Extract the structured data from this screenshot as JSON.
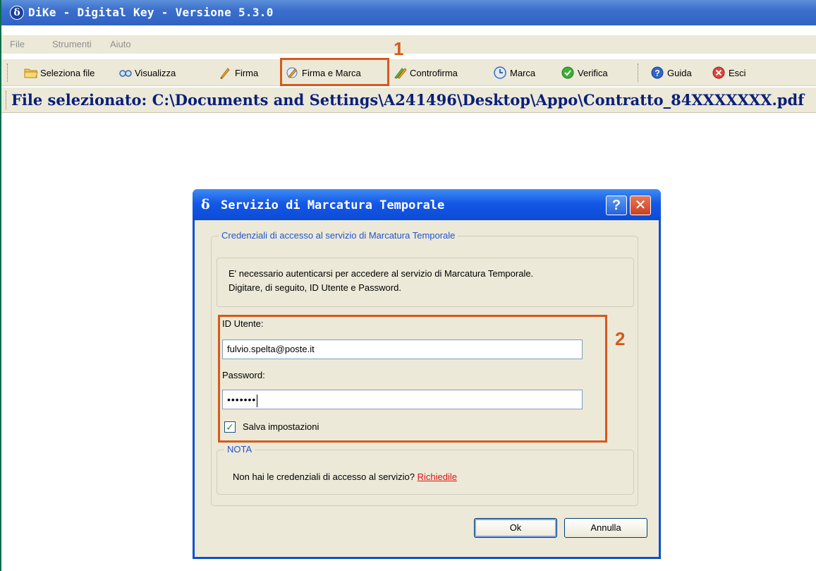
{
  "window": {
    "title": "DiKe - Digital Key - Versione 5.3.0",
    "icon": "delta-icon"
  },
  "menu": [
    "File",
    "Strumenti",
    "Aiuto"
  ],
  "toolbar": {
    "items": [
      {
        "label": "Seleziona file",
        "icon": "folder-icon"
      },
      {
        "label": "Visualizza",
        "icon": "view-icon"
      },
      {
        "label": "Firma",
        "icon": "pen-icon"
      },
      {
        "label": "Firma e Marca",
        "icon": "sign-stamp-icon"
      },
      {
        "label": "Controfirma",
        "icon": "countersign-icon"
      },
      {
        "label": "Marca",
        "icon": "clock-icon"
      },
      {
        "label": "Verifica",
        "icon": "check-icon"
      },
      {
        "label": "Guida",
        "icon": "help-icon"
      },
      {
        "label": "Esci",
        "icon": "exit-icon"
      }
    ]
  },
  "callouts": {
    "one": "1",
    "two": "2"
  },
  "file_bar": {
    "text": "File selezionato: C:\\Documents and Settings\\A241496\\Desktop\\Appo\\Contratto_84XXXXXXX.pdf"
  },
  "dialog": {
    "title": "Servizio di Marcatura Temporale",
    "help_button": "?",
    "close_button": "✕",
    "group_title": "Credenziali di accesso al servizio di Marcatura Temporale",
    "info_line1": "E' necessario autenticarsi per accedere al servizio di Marcatura Temporale.",
    "info_line2": "Digitare, di seguito, ID Utente e Password.",
    "user_label": "ID Utente:",
    "user_value": "fulvio.spelta@poste.it",
    "password_label": "Password:",
    "password_value": "•••••••",
    "save_label": "Salva impostazioni",
    "save_checked": true,
    "note_title": "NOTA",
    "note_text": "Non hai le credenziali di accesso al servizio?",
    "note_link": "Richiedile",
    "ok_label": "Ok",
    "cancel_label": "Annulla"
  },
  "colors": {
    "accent_highlight": "#d55a1c",
    "titlebar_blue": "#0b4bd6",
    "link_red": "#e01010"
  }
}
